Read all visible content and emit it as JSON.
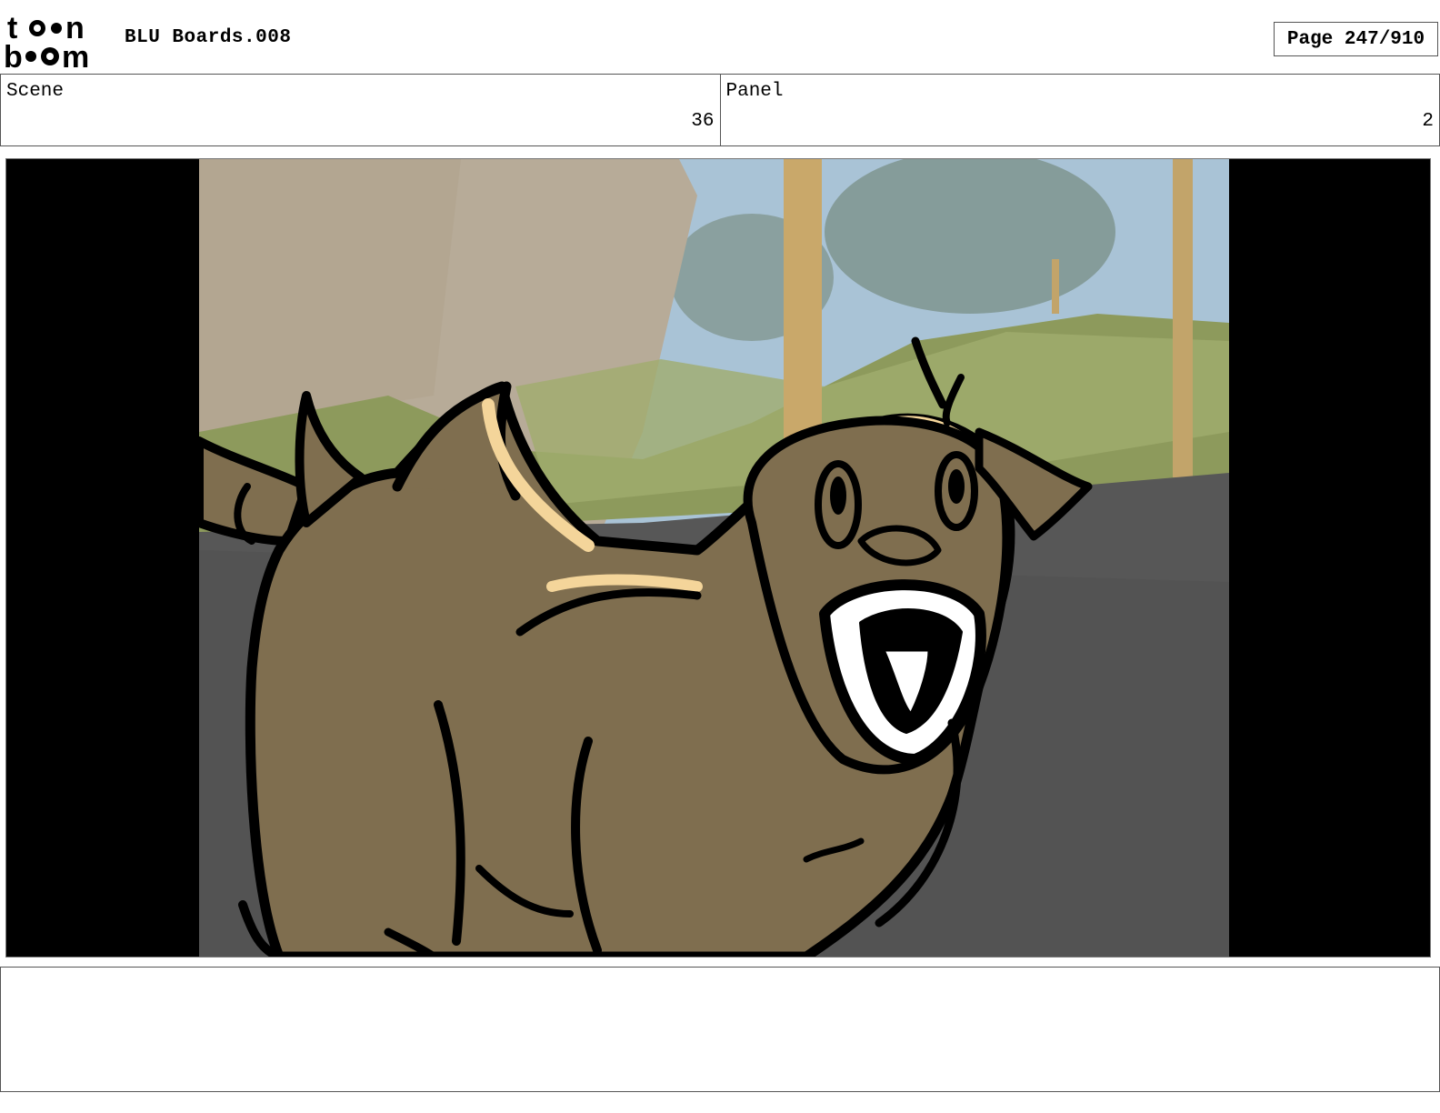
{
  "header": {
    "logo_text": "toon boom",
    "title": "BLU Boards.008",
    "page_label": "Page 247/910"
  },
  "info": {
    "scene_label": "Scene",
    "scene_value": "36",
    "panel_label": "Panel",
    "panel_value": "2"
  },
  "panel_image": {
    "icon": "storyboard-sketch-creature",
    "colors": {
      "letterbox": "#000000",
      "creature_fill": "#7f6e4f",
      "highlight": "#f4d59a",
      "ground": "#575757",
      "sky": "#a9c3d6",
      "grass": "#8d9a5c"
    }
  },
  "notes": {
    "text": ""
  }
}
